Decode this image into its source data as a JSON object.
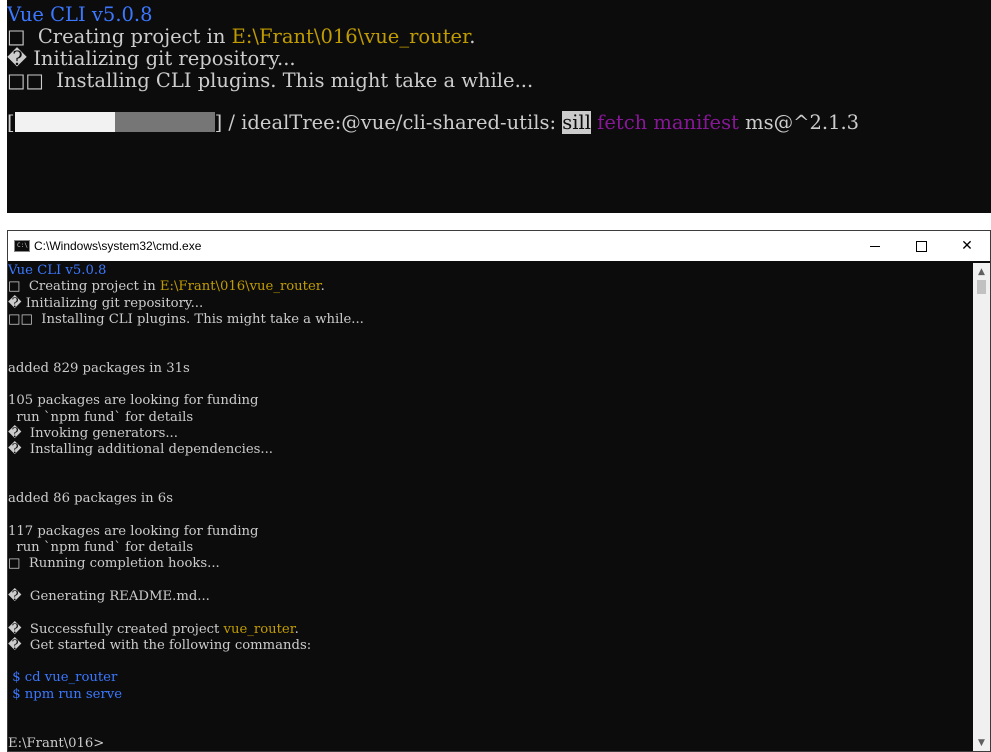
{
  "top_snippet": {
    "line1": "Vue CLI v5.0.8",
    "line2_prefix": "□  Creating project in ",
    "line2_path": "E:\\Frant\\016\\vue_router",
    "line2_suffix": ".",
    "line3": "� Initializing git repository...",
    "line4": "□□  Installing CLI plugins. This might take a while...",
    "progress_open": "[",
    "progress_close": "]",
    "progress_text": " / idealTree:@vue/cli-shared-utils: ",
    "sill": "sill",
    "fetch_manifest": " fetch manifest",
    "pkg": " ms@^2.1.3"
  },
  "window": {
    "title": "C:\\Windows\\system32\\cmd.exe",
    "app_icon_text": "C:\\",
    "minimize": "—",
    "close": "✕"
  },
  "console": {
    "l1": "Vue CLI v5.0.8",
    "l2_prefix": "□  Creating project in ",
    "l2_path": "E:\\Frant\\016\\vue_router",
    "l2_suffix": ".",
    "l3": "� Initializing git repository...",
    "l4": "□□  Installing CLI plugins. This might take a while...",
    "l5": "",
    "l6": "",
    "l7": "added 829 packages in 31s",
    "l8": "",
    "l9": "105 packages are looking for funding",
    "l10": "  run `npm fund` for details",
    "l11": "�  Invoking generators...",
    "l12": "�  Installing additional dependencies...",
    "l13": "",
    "l14": "",
    "l15": "added 86 packages in 6s",
    "l16": "",
    "l17": "117 packages are looking for funding",
    "l18": "  run `npm fund` for details",
    "l19": "□  Running completion hooks...",
    "l20": "",
    "l21": "�  Generating README.md...",
    "l22": "",
    "l23_prefix": "�  Successfully created project ",
    "l23_name": "vue_router",
    "l23_suffix": ".",
    "l24": "�  Get started with the following commands:",
    "l25": "",
    "l26": " $ cd vue_router",
    "l27": " $ npm run serve",
    "l28": "",
    "l29": "",
    "l30": "E:\\Frant\\016>"
  },
  "colors": {
    "background": "#0c0c0c",
    "text": "#cccccc",
    "blue": "#3b78ff",
    "yellow": "#c19c00",
    "magenta": "#881798"
  }
}
